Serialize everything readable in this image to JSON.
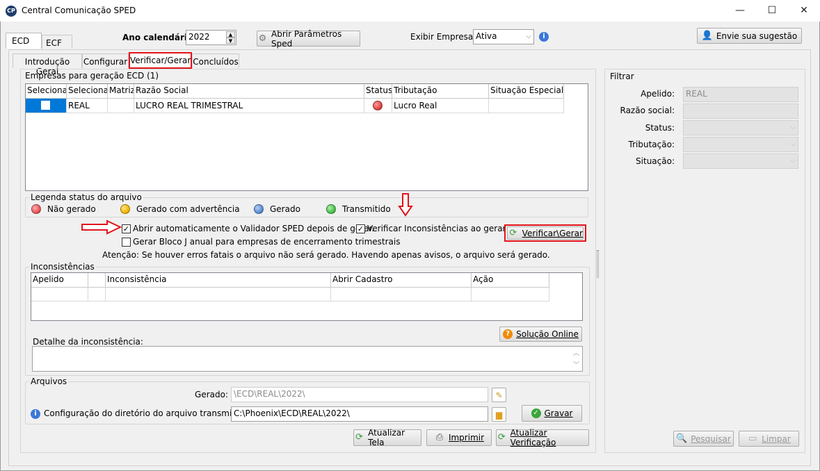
{
  "window": {
    "title": "Central Comunicação SPED",
    "logo_text": "CP",
    "controls": [
      "—",
      "☐",
      "✕"
    ]
  },
  "top_tabs": [
    {
      "label": "ECD",
      "active": true
    },
    {
      "label": "ECF",
      "active": false
    }
  ],
  "year": {
    "label": "Ano calendário:",
    "value": "2022"
  },
  "open_params_button": "Abrir Parâmetros Sped",
  "show_companies": {
    "label": "Exibir Empresas:",
    "value": "Ativa"
  },
  "suggestion_button": "Envie sua sugestão",
  "sub_tabs": [
    {
      "label": "Introdução Geral",
      "active": false
    },
    {
      "label": "Configurar",
      "active": false
    },
    {
      "label": "Verificar/Gerar",
      "active": true
    },
    {
      "label": "Concluídos",
      "active": false
    }
  ],
  "companies": {
    "title": "Empresas para geração ECD (1)",
    "columns": [
      "Selecionar",
      "Selecionar",
      "Matriz",
      "Razão Social",
      "Status",
      "Tributação",
      "Situação Especial"
    ],
    "rows": [
      {
        "selecionar2": "REAL",
        "matriz": "",
        "razao_social": "LUCRO REAL TRIMESTRAL",
        "status_color": "#e24848",
        "tributacao": "Lucro Real",
        "situacao": ""
      }
    ]
  },
  "legend": {
    "title": "Legenda status do arquivo",
    "items": [
      {
        "label": "Não gerado",
        "color": "#e8585c"
      },
      {
        "label": "Gerado com advertência",
        "color": "#f5b800"
      },
      {
        "label": "Gerado",
        "color": "#5b8fd4"
      },
      {
        "label": "Transmitido",
        "color": "#4cc24c"
      }
    ]
  },
  "options": {
    "open_validator": "Abrir automaticamente o Validador SPED depois de gerar.",
    "verify_inconsistencies": "Verificar Inconsistências ao gerar",
    "generate_block_j": "Gerar Bloco J anual para empresas de encerramento trimestrais",
    "warning": "Atenção: Se houver erros fatais o arquivo não será gerado. Havendo apenas avisos, o arquivo será gerado.",
    "verify_button": "Verificar\\Gerar"
  },
  "inconsistencies": {
    "title": "Inconsistências",
    "columns": [
      "Apelido",
      "",
      "Inconsistência",
      "Abrir Cadastro",
      "Ação"
    ],
    "solution_button": "Solução Online",
    "detail_label": "Detalhe da inconsistência:"
  },
  "files": {
    "title": "Arquivos",
    "generated_label": "Gerado:",
    "generated_value": "\\ECD\\REAL\\2022\\",
    "transmitted_label": "Configuração do diretório do arquivo transmitido:",
    "transmitted_value": "C:\\Phoenix\\ECD\\REAL\\2022\\",
    "save_button": "Gravar"
  },
  "bottom_buttons": {
    "refresh_screen": "Atualizar Tela",
    "print": "Imprimir",
    "refresh_verification": "Atualizar Verificação"
  },
  "filter": {
    "title": "Filtrar",
    "apelido_label": "Apelido:",
    "apelido_value": "REAL",
    "razao_label": "Razão social:",
    "status_label": "Status:",
    "tributacao_label": "Tributação:",
    "situacao_label": "Situação:",
    "search_button": "Pesquisar",
    "clear_button": "Limpar"
  },
  "colors": {
    "highlight_red": "#e3141c",
    "selection_blue": "#0078d7"
  }
}
